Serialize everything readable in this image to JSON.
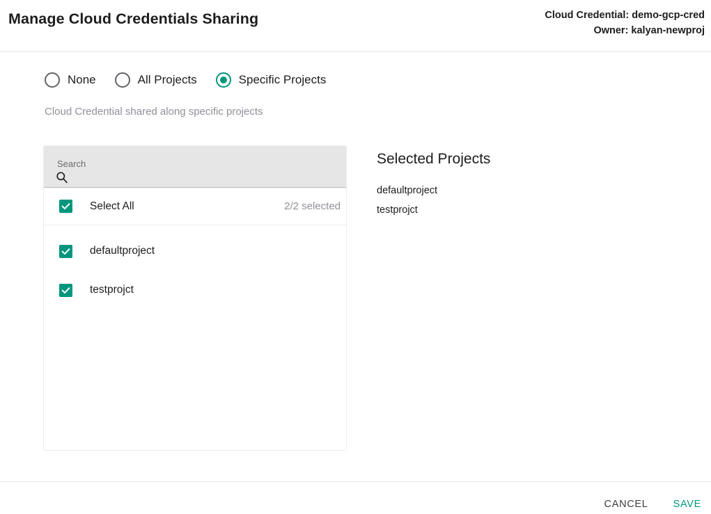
{
  "header": {
    "title": "Manage Cloud Credentials Sharing",
    "credential_line": "Cloud Credential: demo-gcp-cred",
    "owner_line": "Owner: kalyan-newproj"
  },
  "sharing_mode": {
    "options": [
      {
        "label": "None",
        "selected": false
      },
      {
        "label": "All Projects",
        "selected": false
      },
      {
        "label": "Specific Projects",
        "selected": true
      }
    ],
    "hint": "Cloud Credential shared along specific projects"
  },
  "project_picker": {
    "search": {
      "label": "Search",
      "value": "",
      "placeholder": "",
      "icon": "search-icon"
    },
    "select_all": {
      "label": "Select All",
      "checked": true,
      "count_text": "2/2 selected"
    },
    "items": [
      {
        "label": "defaultproject",
        "checked": true
      },
      {
        "label": "testprojct",
        "checked": true
      }
    ]
  },
  "selected_panel": {
    "title": "Selected Projects",
    "items": [
      "defaultproject",
      "testprojct"
    ]
  },
  "footer": {
    "cancel_label": "CANCEL",
    "save_label": "SAVE"
  },
  "colors": {
    "accent": "#00967d",
    "text": "#1d1d1d",
    "muted": "#8e9198",
    "search_bg": "#e6e6e6",
    "divider": "#e4e4e4"
  }
}
